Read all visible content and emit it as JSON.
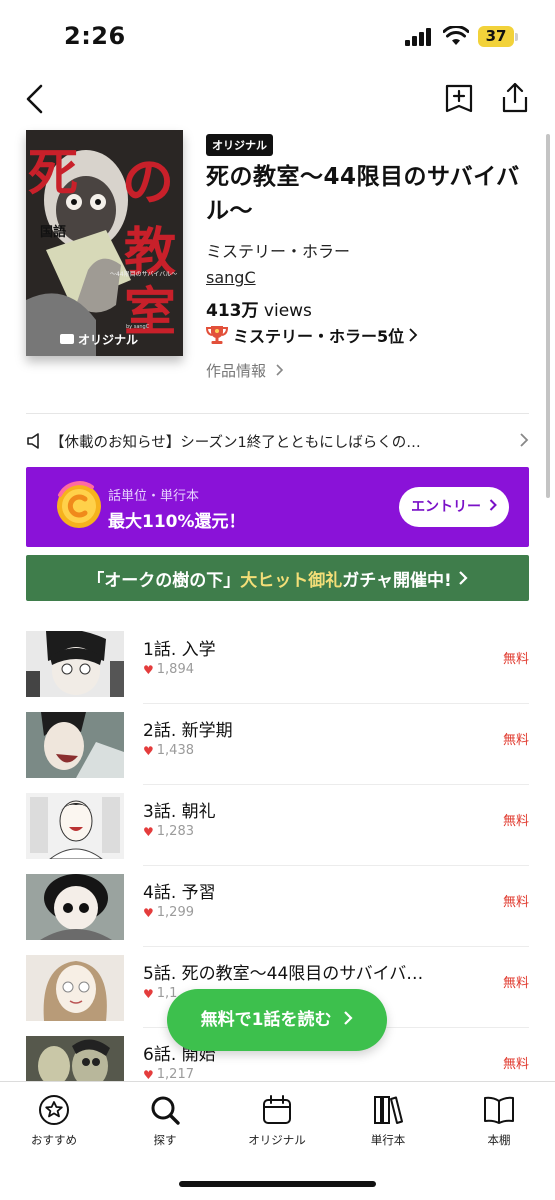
{
  "status_bar": {
    "time": "2:26",
    "battery": "37",
    "battery_color": "#f2d23a"
  },
  "nav": {
    "back_icon": "chevron-left-icon",
    "bookmark_icon": "bookmark-add-icon",
    "share_icon": "share-icon"
  },
  "series": {
    "cover_title_chars": [
      "死",
      "の",
      "教",
      "室"
    ],
    "cover_tag": "国語",
    "cover_subtitle": "〜44限目のサバイバル〜",
    "cover_label": "オリジナル",
    "cover_author": "by sangC",
    "badge": "オリジナル",
    "title": "死の教室〜44限目のサバイバル〜",
    "genre": "ミステリー・ホラー",
    "author": "sangC",
    "views_count": "413万",
    "views_unit": " views",
    "rank": "ミステリー・ホラー5位",
    "info_link": "作品情報"
  },
  "notice": {
    "text": "【休載のお知らせ】シーズン1終了とともにしばらくの…"
  },
  "promo": {
    "small": "話単位・単行本",
    "big": "最大110%還元！",
    "button": "エントリー",
    "accent": "#8a12d8"
  },
  "banner": {
    "part1": "「オークの樹の下」",
    "part2": "大ヒット御礼",
    "part3": "ガチャ開催中!",
    "color": "#3f7d4b"
  },
  "episodes": [
    {
      "title": "1話. 入学",
      "likes": "1,894",
      "price": "無料"
    },
    {
      "title": "2話. 新学期",
      "likes": "1,438",
      "price": "無料"
    },
    {
      "title": "3話. 朝礼",
      "likes": "1,283",
      "price": "無料"
    },
    {
      "title": "4話. 予習",
      "likes": "1,299",
      "price": "無料"
    },
    {
      "title": "5話. 死の教室〜44限目のサバイバ…",
      "likes": "1,1",
      "price": "無料"
    },
    {
      "title": "6話. 開始",
      "likes": "1,217",
      "price": "無料"
    }
  ],
  "cta": {
    "label": "無料で1話を読む",
    "color": "#3dc04d"
  },
  "tabs": [
    {
      "label": "おすすめ",
      "icon": "recommend-icon"
    },
    {
      "label": "探す",
      "icon": "search-icon"
    },
    {
      "label": "オリジナル",
      "icon": "calendar-icon"
    },
    {
      "label": "単行本",
      "icon": "books-icon"
    },
    {
      "label": "本棚",
      "icon": "bookshelf-icon"
    }
  ]
}
